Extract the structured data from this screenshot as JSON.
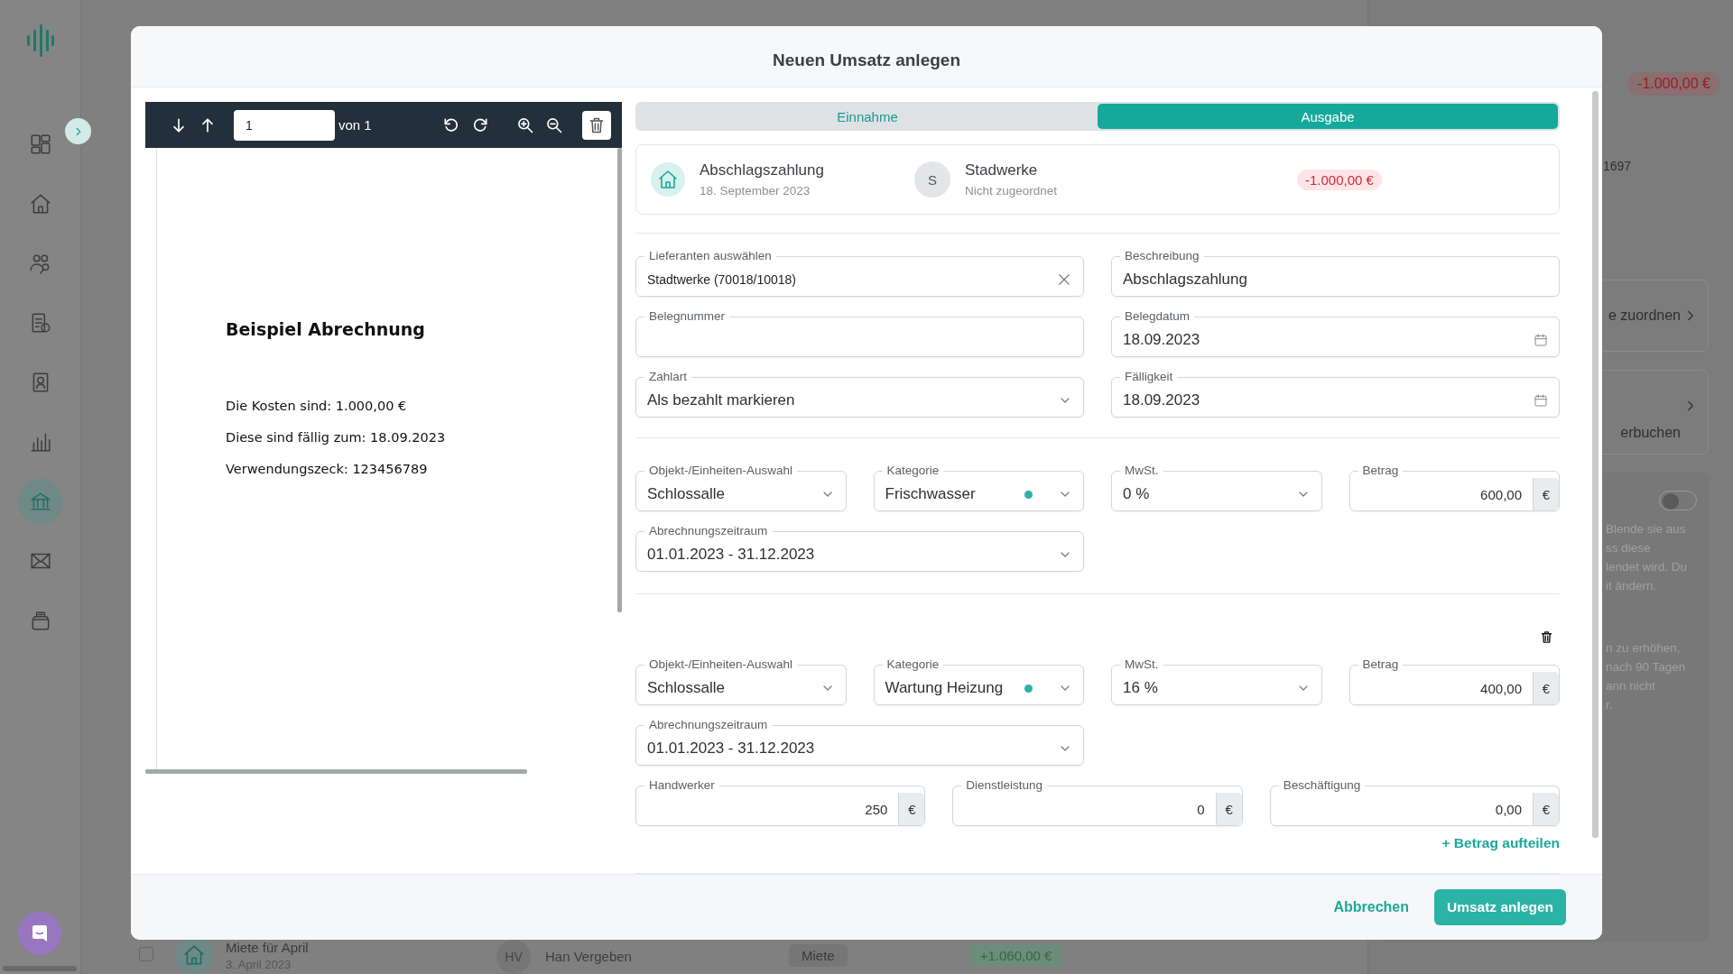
{
  "sidebar": {
    "items": [
      {
        "kind": "dashboard",
        "selected": false
      },
      {
        "kind": "home",
        "selected": false
      },
      {
        "kind": "users",
        "selected": false
      },
      {
        "kind": "billing",
        "selected": false
      },
      {
        "kind": "contacts",
        "selected": false
      },
      {
        "kind": "chart",
        "selected": false
      },
      {
        "kind": "bank",
        "selected": true
      },
      {
        "kind": "mail",
        "selected": false
      },
      {
        "kind": "inbox",
        "selected": false
      }
    ]
  },
  "background_row": {
    "checked": false,
    "title": "Miete für April",
    "date": "3. April 2023",
    "initials": "HV",
    "party": "Han Vergeben",
    "category": "Miete",
    "amount": "+1.060,00 €"
  },
  "right_panel": {
    "amount": "-1.000,00 €",
    "reference": "1697",
    "actions": [
      "e zuordnen",
      "erbuchen"
    ],
    "toggle": {
      "on": false
    },
    "notes": [
      [
        "Blende sie aus",
        "ss diese",
        "lendet wird. Du",
        "it ändern."
      ],
      [
        "n zu erhöhen,",
        "nach 90 Tagen",
        "ann nicht",
        "r."
      ]
    ]
  },
  "dialog": {
    "title": "Neuen Umsatz anlegen",
    "viewer": {
      "page": "1",
      "page_count": "von 1",
      "document": {
        "title": "Beispiel Abrechnung",
        "lines": [
          "Die Kosten sind: 1.000,00 €",
          "Diese sind fällig zum: 18.09.2023",
          "Verwendungszeck: 123456789"
        ]
      }
    },
    "tabs": [
      {
        "label": "Einnahme",
        "selected": false
      },
      {
        "label": "Ausgabe",
        "selected": true
      }
    ],
    "summary": {
      "title": "Abschlagszahlung",
      "date": "18. September 2023",
      "initial": "S",
      "party": "Stadwerke",
      "party_status": "Nicht zugeordnet",
      "amount": "-1.000,00 €"
    },
    "fields": [
      {
        "kind": "clear",
        "label": "Lieferanten auswählen",
        "value": "Stadtwerke (70018/10018)"
      },
      {
        "kind": "text",
        "label": "Beschreibung",
        "value": "Abschlagszahlung"
      },
      {
        "kind": "text",
        "label": "Belegnummer"
      },
      {
        "kind": "date",
        "label": "Belegdatum",
        "value": "18.09.2023"
      },
      {
        "kind": "select",
        "label": "Zahlart",
        "value": "Als bezahlt markieren"
      },
      {
        "kind": "date",
        "label": "Fälligkeit",
        "value": "18.09.2023"
      }
    ],
    "splits": [
      {
        "deletable": false,
        "fields": [
          {
            "kind": "select",
            "label": "Objekt-/Einheiten-Auswahl",
            "value": "Schlossalle"
          },
          {
            "kind": "category",
            "label": "Kategorie",
            "value": "Frischwasser",
            "color": "#2bb3a6"
          },
          {
            "kind": "select",
            "label": "MwSt.",
            "value": "0 %"
          },
          {
            "kind": "amount",
            "label": "Betrag",
            "value": "600,00",
            "currency": "€"
          }
        ],
        "period": {
          "kind": "select",
          "label": "Abrechnungszeitraum",
          "value": "01.01.2023 - 31.12.2023"
        }
      },
      {
        "deletable": true,
        "fields": [
          {
            "kind": "select",
            "label": "Objekt-/Einheiten-Auswahl",
            "value": "Schlossalle"
          },
          {
            "kind": "category",
            "label": "Kategorie",
            "value": "Wartung Heizung",
            "color": "#2bb3a6"
          },
          {
            "kind": "select",
            "label": "MwSt.",
            "value": "16 %"
          },
          {
            "kind": "amount",
            "label": "Betrag",
            "value": "400,00",
            "currency": "€"
          }
        ],
        "period": {
          "kind": "select",
          "label": "Abrechnungszeitraum",
          "value": "01.01.2023 - 31.12.2023"
        },
        "extras": [
          {
            "kind": "amount",
            "label": "Handwerker",
            "value": "250",
            "currency": "€"
          },
          {
            "kind": "amount",
            "label": "Dienstleistung",
            "value": "0",
            "currency": "€"
          },
          {
            "kind": "amount",
            "label": "Beschäftigung",
            "value": "0,00",
            "currency": "€"
          }
        ]
      }
    ],
    "split_link": "+ Betrag aufteilen",
    "buttons": {
      "cancel": "Abbrechen",
      "submit": "Umsatz anlegen"
    }
  }
}
